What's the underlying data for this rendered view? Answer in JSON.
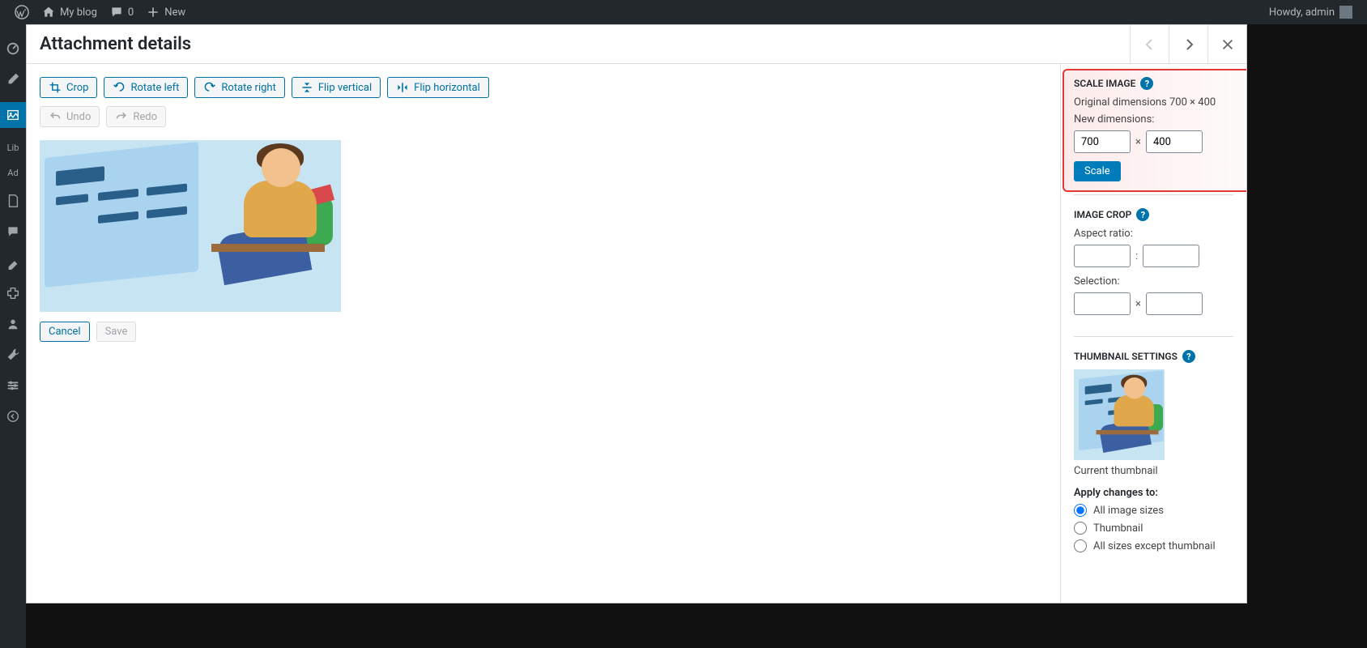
{
  "adminbar": {
    "site_name": "My blog",
    "comments_count": "0",
    "new_label": "New",
    "howdy": "Howdy, admin"
  },
  "adminmenu": {
    "lib_label": "Lib",
    "ad_label": "Ad"
  },
  "modal": {
    "title": "Attachment details"
  },
  "toolbar": {
    "crop": "Crop",
    "rotate_left": "Rotate left",
    "rotate_right": "Rotate right",
    "flip_vertical": "Flip vertical",
    "flip_horizontal": "Flip horizontal",
    "undo": "Undo",
    "redo": "Redo"
  },
  "footer": {
    "cancel": "Cancel",
    "save": "Save"
  },
  "scale": {
    "heading": "Scale Image",
    "original_label": "Original dimensions 700 × 400",
    "new_label": "New dimensions:",
    "width": "700",
    "height": "400",
    "sep": "×",
    "button": "Scale"
  },
  "crop": {
    "heading": "Image Crop",
    "aspect_label": "Aspect ratio:",
    "aspect_sep": ":",
    "selection_label": "Selection:",
    "selection_sep": "×"
  },
  "thumb": {
    "heading": "Thumbnail Settings",
    "current_label": "Current thumbnail",
    "apply_label": "Apply changes to:",
    "opt_all": "All image sizes",
    "opt_thumb": "Thumbnail",
    "opt_except": "All sizes except thumbnail"
  }
}
